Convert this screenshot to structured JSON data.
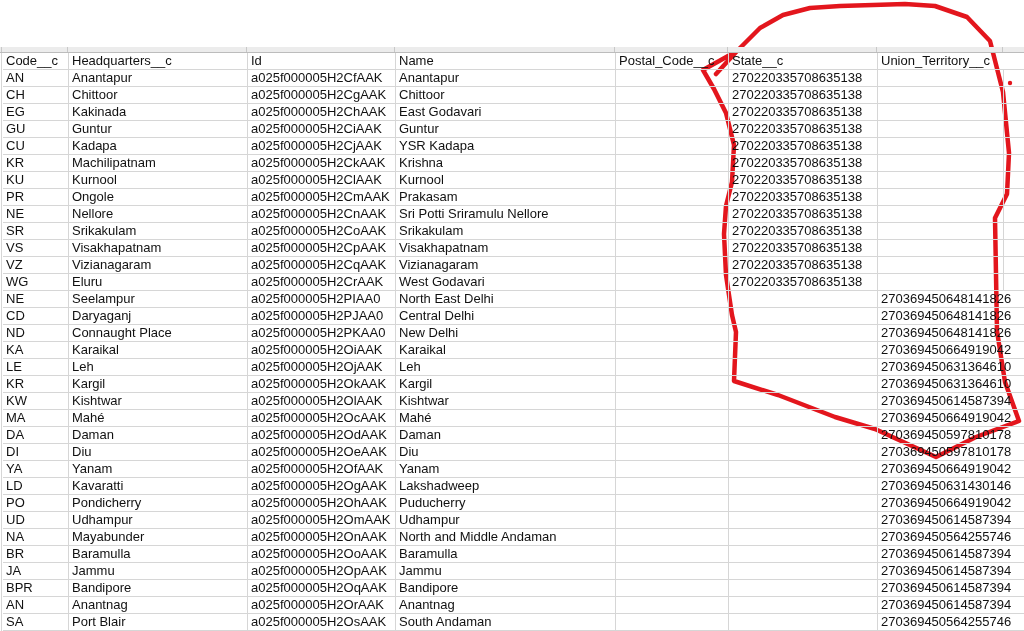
{
  "sheet": {
    "columns": [
      {
        "label": "Code__c"
      },
      {
        "label": "Headquarters__c"
      },
      {
        "label": "Id"
      },
      {
        "label": "Name"
      },
      {
        "label": "Postal_Code__c"
      },
      {
        "label": "State__c"
      },
      {
        "label": "Union_Territory__c"
      }
    ],
    "rows": [
      {
        "code": "AN",
        "headquarters": "Anantapur",
        "id": "a025f000005H2CfAAK",
        "name": "Anantapur",
        "state": "270220335708635138"
      },
      {
        "code": "CH",
        "headquarters": "Chittoor",
        "id": "a025f000005H2CgAAK",
        "name": "Chittoor",
        "state": "270220335708635138"
      },
      {
        "code": "EG",
        "headquarters": "Kakinada",
        "id": "a025f000005H2ChAAK",
        "name": "East Godavari",
        "state": "270220335708635138"
      },
      {
        "code": "GU",
        "headquarters": "Guntur",
        "id": "a025f000005H2CiAAK",
        "name": "Guntur",
        "state": "270220335708635138"
      },
      {
        "code": "CU",
        "headquarters": "Kadapa",
        "id": "a025f000005H2CjAAK",
        "name": "YSR Kadapa",
        "state": "270220335708635138"
      },
      {
        "code": "KR",
        "headquarters": "Machilipatnam",
        "id": "a025f000005H2CkAAK",
        "name": "Krishna",
        "state": "270220335708635138"
      },
      {
        "code": "KU",
        "headquarters": "Kurnool",
        "id": "a025f000005H2ClAAK",
        "name": "Kurnool",
        "state": "270220335708635138"
      },
      {
        "code": "PR",
        "headquarters": "Ongole",
        "id": "a025f000005H2CmAAK",
        "name": "Prakasam",
        "state": "270220335708635138"
      },
      {
        "code": "NE",
        "headquarters": "Nellore",
        "id": "a025f000005H2CnAAK",
        "name": "Sri Potti Sriramulu Nellore",
        "state": "270220335708635138"
      },
      {
        "code": "SR",
        "headquarters": "Srikakulam",
        "id": "a025f000005H2CoAAK",
        "name": "Srikakulam",
        "state": "270220335708635138"
      },
      {
        "code": "VS",
        "headquarters": "Visakhapatnam",
        "id": "a025f000005H2CpAAK",
        "name": "Visakhapatnam",
        "state": "270220335708635138"
      },
      {
        "code": "VZ",
        "headquarters": "Vizianagaram",
        "id": "a025f000005H2CqAAK",
        "name": "Vizianagaram",
        "state": "270220335708635138"
      },
      {
        "code": "WG",
        "headquarters": "Eluru",
        "id": "a025f000005H2CrAAK",
        "name": "West Godavari",
        "state": "270220335708635138"
      },
      {
        "code": "NE",
        "headquarters": "Seelampur",
        "id": "a025f000005H2PIAA0",
        "name": "North East Delhi",
        "union_territory": "270369450648141826"
      },
      {
        "code": "CD",
        "headquarters": "Daryaganj",
        "id": "a025f000005H2PJAA0",
        "name": "Central Delhi",
        "union_territory": "270369450648141826"
      },
      {
        "code": "ND",
        "headquarters": "Connaught Place",
        "id": "a025f000005H2PKAA0",
        "name": "New Delhi",
        "union_territory": "270369450648141826"
      },
      {
        "code": "KA",
        "headquarters": "Karaikal",
        "id": "a025f000005H2OiAAK",
        "name": "Karaikal",
        "union_territory": "270369450664919042"
      },
      {
        "code": "LE",
        "headquarters": "Leh",
        "id": "a025f000005H2OjAAK",
        "name": "Leh",
        "union_territory": "270369450631364610"
      },
      {
        "code": "KR",
        "headquarters": "Kargil",
        "id": "a025f000005H2OkAAK",
        "name": "Kargil",
        "union_territory": "270369450631364610"
      },
      {
        "code": "KW",
        "headquarters": "Kishtwar",
        "id": "a025f000005H2OlAAK",
        "name": "Kishtwar",
        "union_territory": "270369450614587394"
      },
      {
        "code": "MA",
        "headquarters": "Mahé",
        "id": "a025f000005H2OcAAK",
        "name": "Mahé",
        "union_territory": "270369450664919042"
      },
      {
        "code": "DA",
        "headquarters": "Daman",
        "id": "a025f000005H2OdAAK",
        "name": "Daman",
        "union_territory": "270369450597810178"
      },
      {
        "code": "DI",
        "headquarters": "Diu",
        "id": "a025f000005H2OeAAK",
        "name": "Diu",
        "union_territory": "270369450597810178"
      },
      {
        "code": "YA",
        "headquarters": "Yanam",
        "id": "a025f000005H2OfAAK",
        "name": "Yanam",
        "union_territory": "270369450664919042"
      },
      {
        "code": "LD",
        "headquarters": "Kavaratti",
        "id": "a025f000005H2OgAAK",
        "name": "Lakshadweep",
        "union_territory": "270369450631430146"
      },
      {
        "code": "PO",
        "headquarters": "Pondicherry",
        "id": "a025f000005H2OhAAK",
        "name": "Puducherry",
        "union_territory": "270369450664919042"
      },
      {
        "code": "UD",
        "headquarters": "Udhampur",
        "id": "a025f000005H2OmAAK",
        "name": "Udhampur",
        "union_territory": "270369450614587394"
      },
      {
        "code": "NA",
        "headquarters": "Mayabunder",
        "id": "a025f000005H2OnAAK",
        "name": "North and Middle Andaman",
        "union_territory": "270369450564255746"
      },
      {
        "code": "BR",
        "headquarters": "Baramulla",
        "id": "a025f000005H2OoAAK",
        "name": "Baramulla",
        "union_territory": "270369450614587394"
      },
      {
        "code": "JA",
        "headquarters": "Jammu",
        "id": "a025f000005H2OpAAK",
        "name": "Jammu",
        "union_territory": "270369450614587394"
      },
      {
        "code": "BPR",
        "headquarters": "Bandipore",
        "id": "a025f000005H2OqAAK",
        "name": "Bandipore",
        "union_territory": "270369450614587394"
      },
      {
        "code": "AN",
        "headquarters": "Anantnag",
        "id": "a025f000005H2OrAAK",
        "name": "Anantnag",
        "union_territory": "270369450614587394"
      },
      {
        "code": "SA",
        "headquarters": "Port Blair",
        "id": "a025f000005H2OsAAK",
        "name": "South Andaman",
        "union_territory": "270369450564255746"
      }
    ]
  }
}
